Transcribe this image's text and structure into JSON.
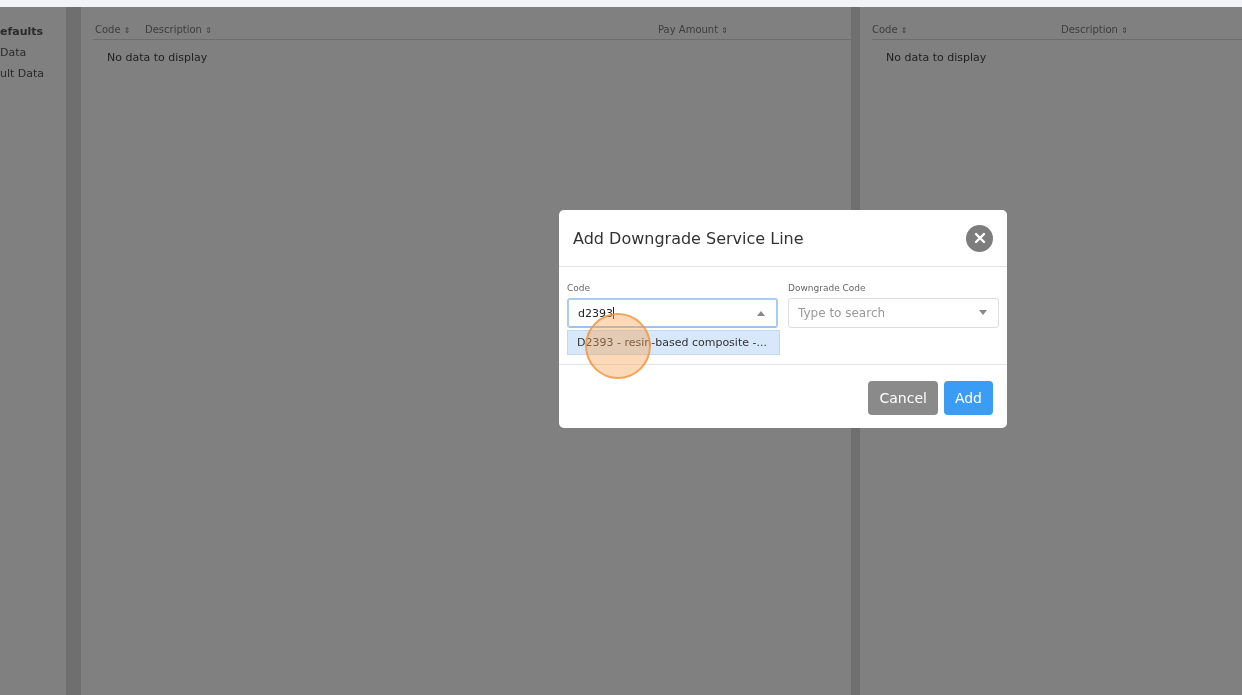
{
  "sidebar": {
    "items": [
      {
        "label": "efaults",
        "selected": true
      },
      {
        "label": "Data",
        "selected": false
      },
      {
        "label": "ult Data",
        "selected": false
      }
    ]
  },
  "left_table": {
    "columns": [
      {
        "label": "Code",
        "sort_icon": "⇕"
      },
      {
        "label": "Description",
        "sort_icon": "⇕"
      },
      {
        "label": "Pay Amount",
        "sort_icon": "⇕"
      }
    ],
    "empty_text": "No data to display"
  },
  "right_table": {
    "columns": [
      {
        "label": "Code",
        "sort_icon": "⇕"
      },
      {
        "label": "Description",
        "sort_icon": "⇕"
      }
    ],
    "empty_text": "No data to display"
  },
  "dialog": {
    "title": "Add Downgrade Service Line",
    "fields": [
      {
        "label": "Code",
        "value": "d2393",
        "expanded": true,
        "options": [
          {
            "label": "D2393 - resin-based composite -...",
            "selected": true
          }
        ]
      },
      {
        "label": "Downgrade Code",
        "placeholder": "Type to search",
        "expanded": false
      }
    ],
    "buttons": [
      {
        "label": "Cancel",
        "kind": "secondary"
      },
      {
        "label": "Add",
        "kind": "primary"
      }
    ]
  }
}
